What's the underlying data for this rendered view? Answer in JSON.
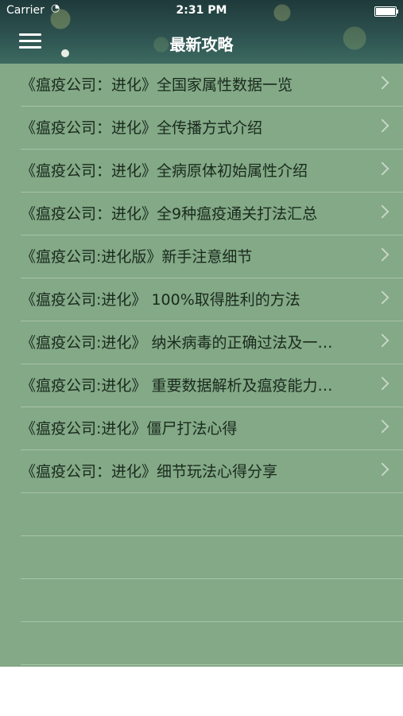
{
  "status_bar": {
    "carrier": "Carrier",
    "wifi_icon": "wifi-icon",
    "time": "2:31 PM",
    "battery_level": 1.0
  },
  "nav": {
    "title": "最新攻略",
    "menu_icon": "hamburger-menu-icon"
  },
  "articles": [
    "《瘟疫公司：进化》全国家属性数据一览",
    "《瘟疫公司：进化》全传播方式介绍",
    "《瘟疫公司：进化》全病原体初始属性介绍",
    "《瘟疫公司：进化》全9种瘟疫通关打法汇总",
    "《瘟疫公司:进化版》新手注意细节",
    "《瘟疫公司:进化》 100%取得胜利的方法",
    "《瘟疫公司:进化》 纳米病毒的正确过法及一…",
    "《瘟疫公司:进化》 重要数据解析及瘟疫能力…",
    "《瘟疫公司:进化》僵尸打法心得",
    "《瘟疫公司：进化》细节玩法心得分享"
  ],
  "colors": {
    "list_background": "#83a987",
    "separator": "#a9c3a8",
    "text": "#1a2a1c"
  }
}
